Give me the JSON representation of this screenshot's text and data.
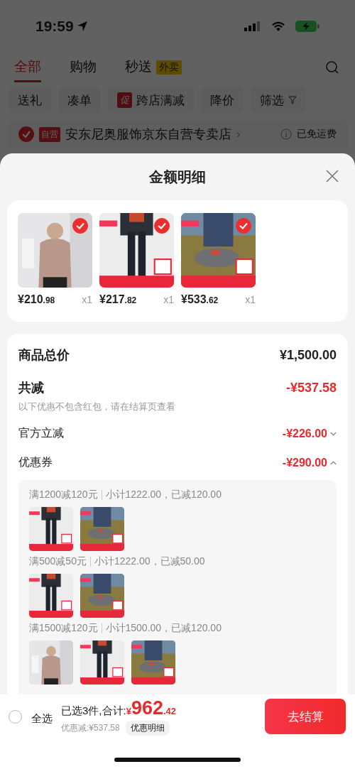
{
  "status_bar": {
    "time": "19:59"
  },
  "tabs": [
    {
      "label": "全部",
      "selected": true
    },
    {
      "label": "购物",
      "selected": false
    },
    {
      "label": "秒送",
      "selected": false,
      "badge": "外卖"
    }
  ],
  "filters": [
    {
      "label": "送礼"
    },
    {
      "label": "凑单"
    },
    {
      "label": "跨店满减",
      "tag": "促"
    },
    {
      "label": "降价"
    },
    {
      "label": "筛选",
      "kind": "filter"
    }
  ],
  "store": {
    "checked": true,
    "badge": "自营",
    "name": "安东尼奥服饰京东自营专卖店",
    "chevron": "›",
    "shipping": "已免运费"
  },
  "sheet": {
    "title": "金额明细",
    "products": [
      {
        "selected": true,
        "price": "¥210",
        "decimals": ".98",
        "quantity": "x1"
      },
      {
        "selected": true,
        "price": "¥217",
        "decimals": ".82",
        "quantity": "x1"
      },
      {
        "selected": true,
        "price": "¥533",
        "decimals": ".62",
        "quantity": "x1"
      }
    ],
    "total": {
      "label": "商品总价",
      "value": "¥1,500.00"
    },
    "reduction": {
      "label": "共减",
      "value": "-¥537.58",
      "note": "以下优惠不包含红包，请在结算页查看"
    },
    "discounts": [
      {
        "label": "官方立减",
        "value": "-¥226.00",
        "expanded": false
      },
      {
        "label": "优惠券",
        "value": "-¥290.00",
        "expanded": true
      }
    ],
    "coupon_groups": [
      {
        "rule": "满1200减120元",
        "detail": "小计1222.00，已减120.00"
      },
      {
        "rule": "满500减50元",
        "detail": "小计1222.00，已减50.00"
      },
      {
        "rule": "满1500减120元",
        "detail": "小计1500.00，已减120.00"
      }
    ]
  },
  "checkout": {
    "select_all": {
      "label": "全选",
      "checked": false
    },
    "summary": "已选3件,合计:",
    "currency": "¥",
    "amount": "962",
    "decimals": ".42",
    "saving": "优惠减:¥537.58",
    "details_button": "优惠明细",
    "button": "去结算"
  }
}
